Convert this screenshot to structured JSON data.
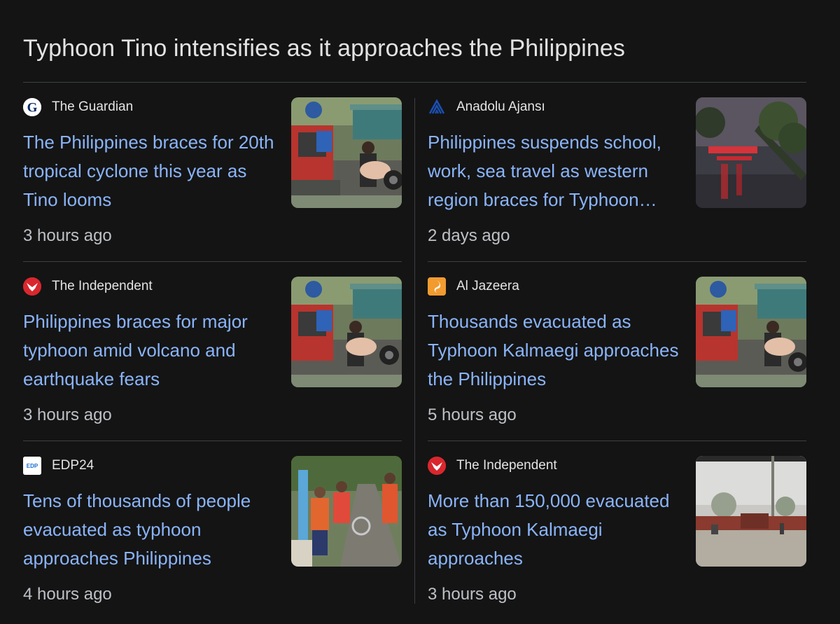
{
  "topic": {
    "title": "Typhoon Tino intensifies as it approaches the Philippines"
  },
  "articles": [
    {
      "source": "The Guardian",
      "source_icon": "guardian-logo-icon",
      "headline": "The Philippines braces for 20th tropical cyclone this year as Tino looms",
      "time": "3 hours ago",
      "thumbnail": "people-loading-tricycle-photo"
    },
    {
      "source": "Anadolu Ajansı",
      "source_icon": "anadolu-logo-icon",
      "headline": "Philippines suspends school, work, sea travel as western region braces for Typhoon…",
      "time": "2 days ago",
      "thumbnail": "fallen-tree-red-lights-photo"
    },
    {
      "source": "The Independent",
      "source_icon": "independent-eagle-icon",
      "headline": "Philippines braces for major typhoon amid volcano and earthquake fears",
      "time": "3 hours ago",
      "thumbnail": "people-loading-tricycle-photo"
    },
    {
      "source": "Al Jazeera",
      "source_icon": "aljazeera-logo-icon",
      "headline": "Thousands evacuated as Typhoon Kalmaegi approaches the Philippines",
      "time": "5 hours ago",
      "thumbnail": "people-loading-tricycle-photo"
    },
    {
      "source": "EDP24",
      "source_icon": "edp24-logo-icon",
      "source_logo_text": "EDP",
      "headline": "Tens of thousands of people evacuated as typhoon approaches Philippines",
      "time": "4 hours ago",
      "thumbnail": "rescue-workers-street-photo"
    },
    {
      "source": "The Independent",
      "source_icon": "independent-eagle-icon",
      "headline": "More than 150,000 evacuated as Typhoon Kalmaegi approaches",
      "time": "3 hours ago",
      "thumbnail": "flooded-street-rain-photo"
    }
  ],
  "colors": {
    "background": "#141414",
    "headline_link": "#8ab4f8",
    "text": "#e3e3e3",
    "muted": "#bdc1c6",
    "divider": "#3c4043"
  }
}
